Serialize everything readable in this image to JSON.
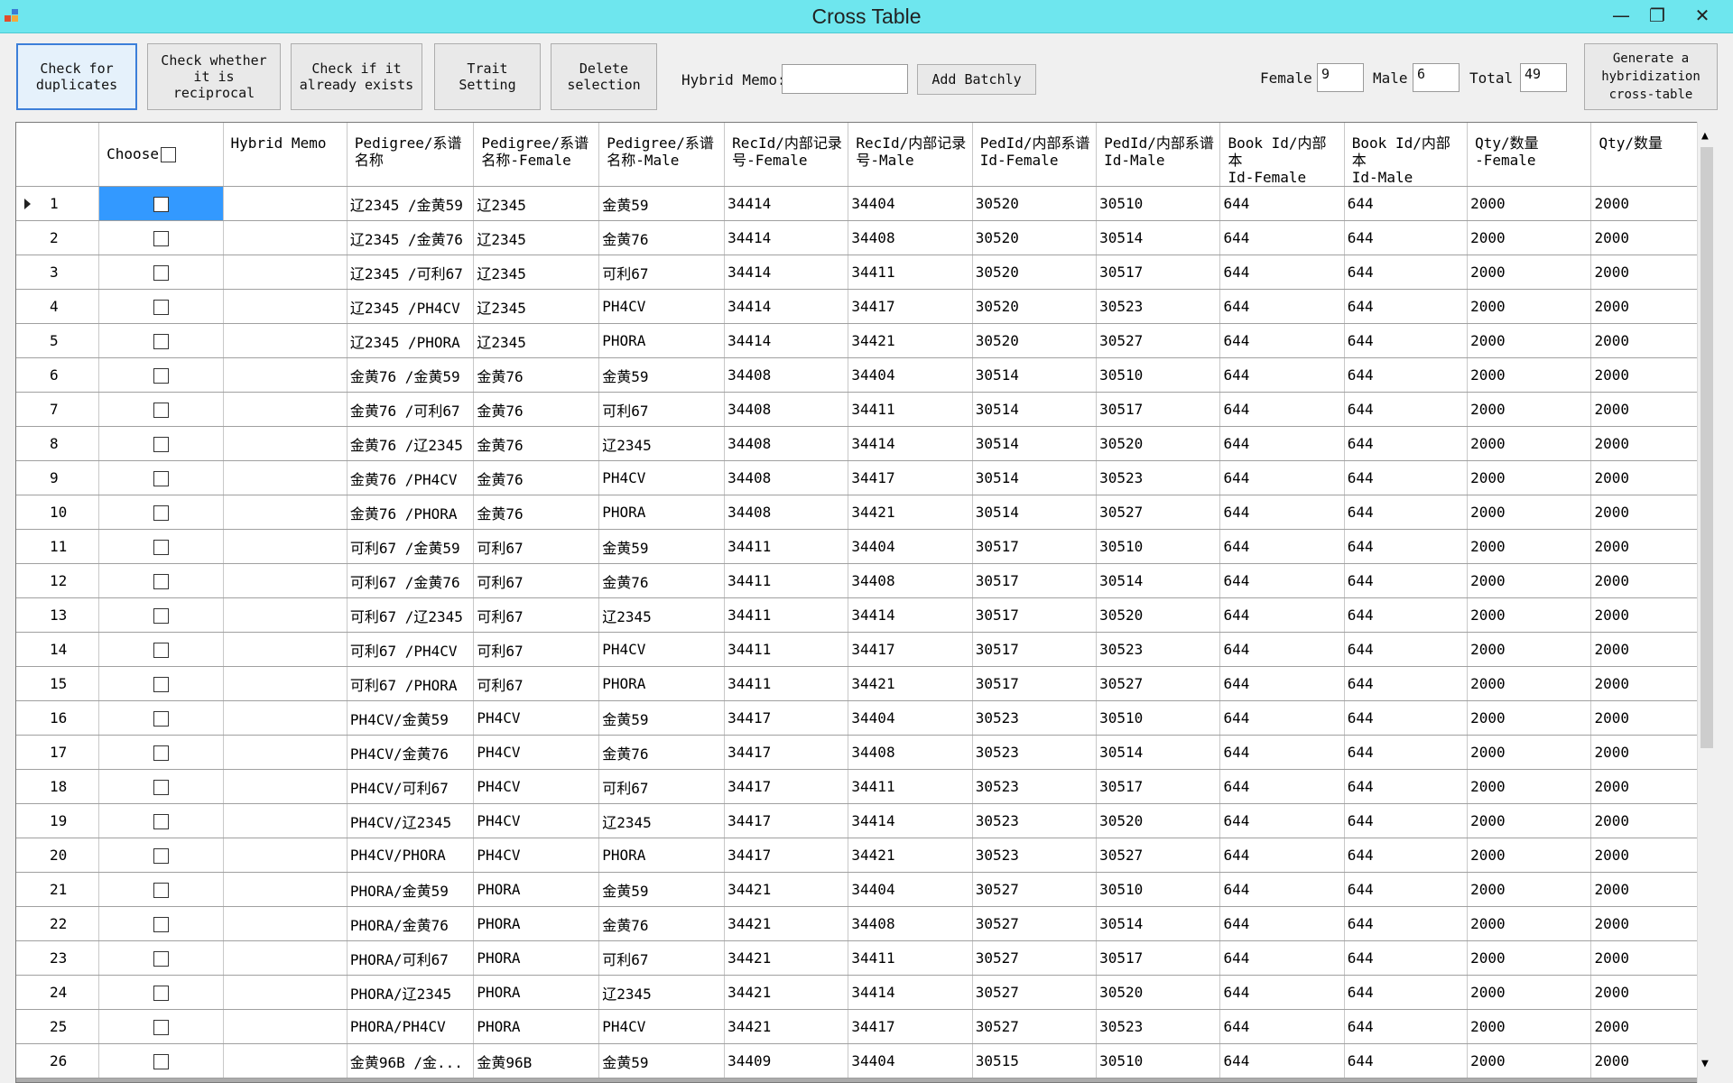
{
  "window": {
    "title": "Cross Table"
  },
  "toolbar": {
    "check_duplicates": "Check for\nduplicates",
    "check_reciprocal": "Check whether\nit is\nreciprocal",
    "check_exists": "Check if it\nalready exists",
    "trait_setting": "Trait\nSetting",
    "delete_selection": "Delete\nselection",
    "hybrid_memo_label": "Hybrid Memo:",
    "hybrid_memo_value": "",
    "add_batchly": "Add Batchly",
    "female_label": "Female",
    "female_value": "9",
    "male_label": "Male",
    "male_value": "6",
    "total_label": "Total",
    "total_value": "49",
    "generate": "Generate a\nhybridization\ncross-table"
  },
  "grid": {
    "columns": [
      "",
      "Choose",
      "Hybrid Memo",
      "Pedigree/系谱\n名称",
      "Pedigree/系谱\n名称-Female",
      "Pedigree/系谱\n名称-Male",
      "RecId/内部记录\n号-Female",
      "RecId/内部记录\n号-Male",
      "PedId/内部系谱\nId-Female",
      "PedId/内部系谱\nId-Male",
      "Book Id/内部本\nId-Female",
      "Book Id/内部本\nId-Male",
      "Qty/数量\n-Female",
      "Qty/数量"
    ],
    "rows": [
      [
        "1",
        "",
        "",
        "辽2345 /金黄59",
        "辽2345",
        "金黄59",
        "34414",
        "34404",
        "30520",
        "30510",
        "644",
        "644",
        "2000",
        "2000"
      ],
      [
        "2",
        "",
        "",
        "辽2345 /金黄76",
        "辽2345",
        "金黄76",
        "34414",
        "34408",
        "30520",
        "30514",
        "644",
        "644",
        "2000",
        "2000"
      ],
      [
        "3",
        "",
        "",
        "辽2345 /可利67",
        "辽2345",
        "可利67",
        "34414",
        "34411",
        "30520",
        "30517",
        "644",
        "644",
        "2000",
        "2000"
      ],
      [
        "4",
        "",
        "",
        "辽2345 /PH4CV",
        "辽2345",
        "PH4CV",
        "34414",
        "34417",
        "30520",
        "30523",
        "644",
        "644",
        "2000",
        "2000"
      ],
      [
        "5",
        "",
        "",
        "辽2345 /PHORA",
        "辽2345",
        "PHORA",
        "34414",
        "34421",
        "30520",
        "30527",
        "644",
        "644",
        "2000",
        "2000"
      ],
      [
        "6",
        "",
        "",
        "金黄76 /金黄59",
        "金黄76",
        "金黄59",
        "34408",
        "34404",
        "30514",
        "30510",
        "644",
        "644",
        "2000",
        "2000"
      ],
      [
        "7",
        "",
        "",
        "金黄76 /可利67",
        "金黄76",
        "可利67",
        "34408",
        "34411",
        "30514",
        "30517",
        "644",
        "644",
        "2000",
        "2000"
      ],
      [
        "8",
        "",
        "",
        "金黄76 /辽2345",
        "金黄76",
        "辽2345",
        "34408",
        "34414",
        "30514",
        "30520",
        "644",
        "644",
        "2000",
        "2000"
      ],
      [
        "9",
        "",
        "",
        "金黄76 /PH4CV",
        "金黄76",
        "PH4CV",
        "34408",
        "34417",
        "30514",
        "30523",
        "644",
        "644",
        "2000",
        "2000"
      ],
      [
        "10",
        "",
        "",
        "金黄76 /PHORA",
        "金黄76",
        "PHORA",
        "34408",
        "34421",
        "30514",
        "30527",
        "644",
        "644",
        "2000",
        "2000"
      ],
      [
        "11",
        "",
        "",
        "可利67 /金黄59",
        "可利67",
        "金黄59",
        "34411",
        "34404",
        "30517",
        "30510",
        "644",
        "644",
        "2000",
        "2000"
      ],
      [
        "12",
        "",
        "",
        "可利67 /金黄76",
        "可利67",
        "金黄76",
        "34411",
        "34408",
        "30517",
        "30514",
        "644",
        "644",
        "2000",
        "2000"
      ],
      [
        "13",
        "",
        "",
        "可利67 /辽2345",
        "可利67",
        "辽2345",
        "34411",
        "34414",
        "30517",
        "30520",
        "644",
        "644",
        "2000",
        "2000"
      ],
      [
        "14",
        "",
        "",
        "可利67 /PH4CV",
        "可利67",
        "PH4CV",
        "34411",
        "34417",
        "30517",
        "30523",
        "644",
        "644",
        "2000",
        "2000"
      ],
      [
        "15",
        "",
        "",
        "可利67 /PHORA",
        "可利67",
        "PHORA",
        "34411",
        "34421",
        "30517",
        "30527",
        "644",
        "644",
        "2000",
        "2000"
      ],
      [
        "16",
        "",
        "",
        "PH4CV/金黄59",
        "PH4CV",
        "金黄59",
        "34417",
        "34404",
        "30523",
        "30510",
        "644",
        "644",
        "2000",
        "2000"
      ],
      [
        "17",
        "",
        "",
        "PH4CV/金黄76",
        "PH4CV",
        "金黄76",
        "34417",
        "34408",
        "30523",
        "30514",
        "644",
        "644",
        "2000",
        "2000"
      ],
      [
        "18",
        "",
        "",
        "PH4CV/可利67",
        "PH4CV",
        "可利67",
        "34417",
        "34411",
        "30523",
        "30517",
        "644",
        "644",
        "2000",
        "2000"
      ],
      [
        "19",
        "",
        "",
        "PH4CV/辽2345",
        "PH4CV",
        "辽2345",
        "34417",
        "34414",
        "30523",
        "30520",
        "644",
        "644",
        "2000",
        "2000"
      ],
      [
        "20",
        "",
        "",
        "PH4CV/PHORA",
        "PH4CV",
        "PHORA",
        "34417",
        "34421",
        "30523",
        "30527",
        "644",
        "644",
        "2000",
        "2000"
      ],
      [
        "21",
        "",
        "",
        "PHORA/金黄59",
        "PHORA",
        "金黄59",
        "34421",
        "34404",
        "30527",
        "30510",
        "644",
        "644",
        "2000",
        "2000"
      ],
      [
        "22",
        "",
        "",
        "PHORA/金黄76",
        "PHORA",
        "金黄76",
        "34421",
        "34408",
        "30527",
        "30514",
        "644",
        "644",
        "2000",
        "2000"
      ],
      [
        "23",
        "",
        "",
        "PHORA/可利67",
        "PHORA",
        "可利67",
        "34421",
        "34411",
        "30527",
        "30517",
        "644",
        "644",
        "2000",
        "2000"
      ],
      [
        "24",
        "",
        "",
        "PHORA/辽2345",
        "PHORA",
        "辽2345",
        "34421",
        "34414",
        "30527",
        "30520",
        "644",
        "644",
        "2000",
        "2000"
      ],
      [
        "25",
        "",
        "",
        "PHORA/PH4CV",
        "PHORA",
        "PH4CV",
        "34421",
        "34417",
        "30527",
        "30523",
        "644",
        "644",
        "2000",
        "2000"
      ],
      [
        "26",
        "",
        "",
        "金黄96B /金...",
        "金黄96B",
        "金黄59",
        "34409",
        "34404",
        "30515",
        "30510",
        "644",
        "644",
        "2000",
        "2000"
      ]
    ],
    "current_row": 0,
    "selection_color": "#3399ff"
  },
  "icons": {
    "app": "app-icon",
    "minimize": "minimize-icon",
    "maximize": "maximize-icon",
    "close": "close-icon",
    "current_row": "current-row-indicator-icon"
  }
}
